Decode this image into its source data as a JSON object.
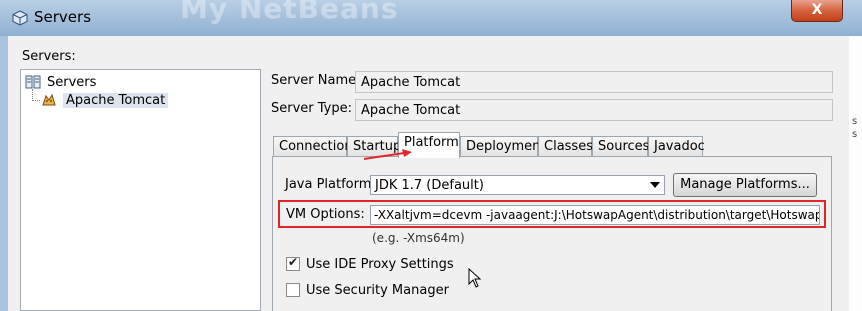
{
  "window": {
    "title": "Servers",
    "background_text": "My NetBeans",
    "close_label": "X"
  },
  "servers_label": "Servers:",
  "tree": {
    "root": "Servers",
    "child": "Apache Tomcat"
  },
  "server_name": {
    "label": "Server Name:",
    "value": "Apache Tomcat"
  },
  "server_type": {
    "label": "Server Type:",
    "value": "Apache Tomcat"
  },
  "tabs": [
    {
      "label": "Connection",
      "active": false
    },
    {
      "label": "Startup",
      "active": false
    },
    {
      "label": "Platform",
      "active": true
    },
    {
      "label": "Deployment",
      "active": false
    },
    {
      "label": "Classes",
      "active": false
    },
    {
      "label": "Sources",
      "active": false
    },
    {
      "label": "Javadoc",
      "active": false
    }
  ],
  "platform": {
    "java_platform_label": "Java Platform:",
    "java_platform_value": "JDK 1.7 (Default)",
    "manage_button": "Manage Platforms...",
    "vm_options_label": "VM Options:",
    "vm_options_value": "-XXaltjvm=dcevm -javaagent:J:\\HotswapAgent\\distribution\\target\\HotswapAgent",
    "vm_options_hint": "(e.g. -Xms64m)",
    "use_proxy_label": "Use IDE Proxy Settings",
    "use_proxy_checked": true,
    "security_label": "Use Security Manager",
    "security_checked": false
  },
  "right_strip": [
    "s",
    "s"
  ],
  "colors": {
    "highlight": "#e0262b",
    "title_bar": "#a7c1dc"
  }
}
